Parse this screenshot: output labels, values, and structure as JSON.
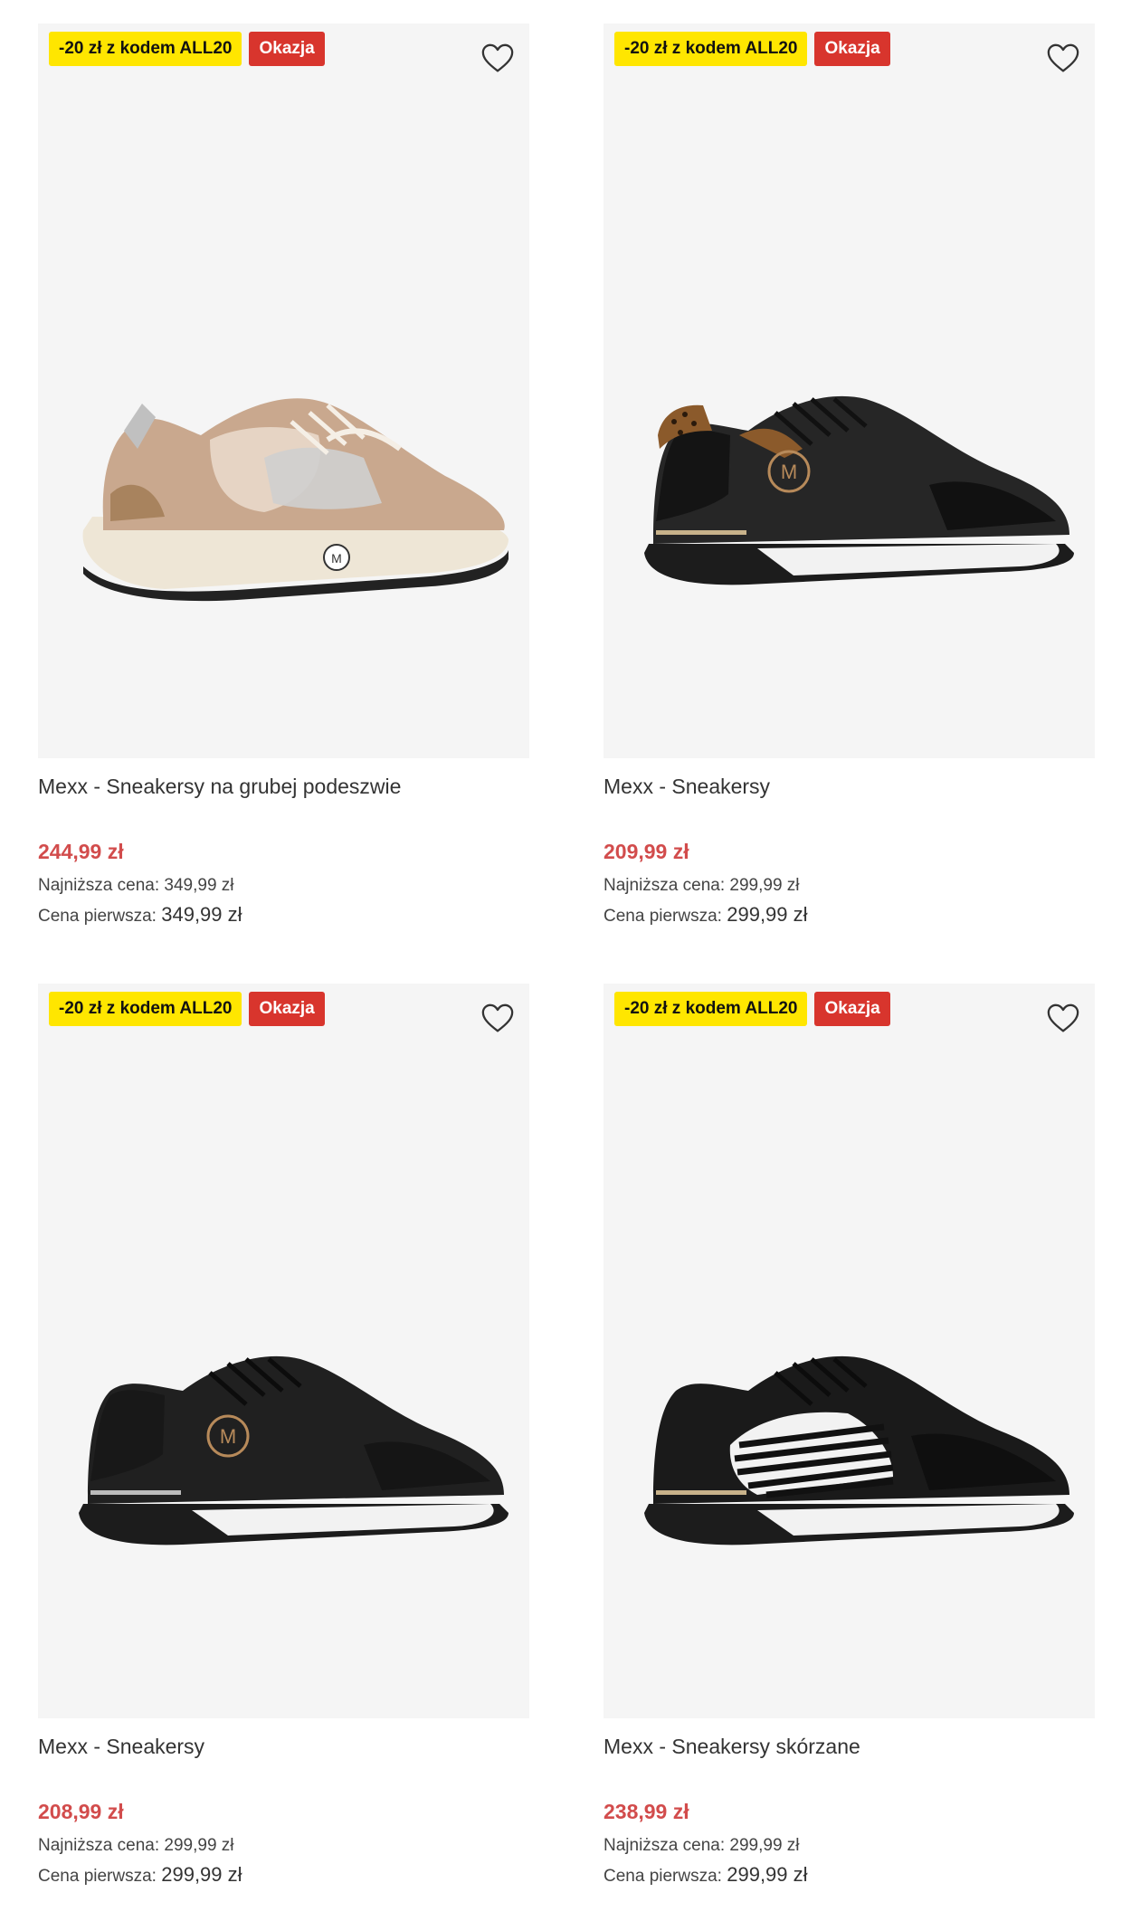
{
  "products": [
    {
      "badge_code": "-20 zł z kodem ALL20",
      "badge_sale": "Okazja",
      "title": "Mexx - Sneakersy na grubej podeszwie",
      "price": "244,99 zł",
      "lowest_label": "Najniższa cena:",
      "lowest_value": "349,99 zł",
      "first_label": "Cena pierwsza:",
      "first_value": "349,99 zł",
      "image_style": "beige-chunky"
    },
    {
      "badge_code": "-20 zł z kodem ALL20",
      "badge_sale": "Okazja",
      "title": "Mexx - Sneakersy",
      "price": "209,99 zł",
      "lowest_label": "Najniższa cena:",
      "lowest_value": "299,99 zł",
      "first_label": "Cena pierwsza:",
      "first_value": "299,99 zł",
      "image_style": "black-leopard"
    },
    {
      "badge_code": "-20 zł z kodem ALL20",
      "badge_sale": "Okazja",
      "title": "Mexx - Sneakersy",
      "price": "208,99 zł",
      "lowest_label": "Najniższa cena:",
      "lowest_value": "299,99 zł",
      "first_label": "Cena pierwsza:",
      "first_value": "299,99 zł",
      "image_style": "black-plain"
    },
    {
      "badge_code": "-20 zł z kodem ALL20",
      "badge_sale": "Okazja",
      "title": "Mexx - Sneakersy skórzane",
      "price": "238,99 zł",
      "lowest_label": "Najniższa cena:",
      "lowest_value": "299,99 zł",
      "first_label": "Cena pierwsza:",
      "first_value": "299,99 zł",
      "image_style": "black-zebra"
    }
  ],
  "colors": {
    "badge_code_bg": "#ffe600",
    "badge_sale_bg": "#d8352d",
    "price": "#d24c4c",
    "image_bg": "#f5f5f5"
  },
  "icons": {
    "favorite": "heart-outline-icon"
  }
}
